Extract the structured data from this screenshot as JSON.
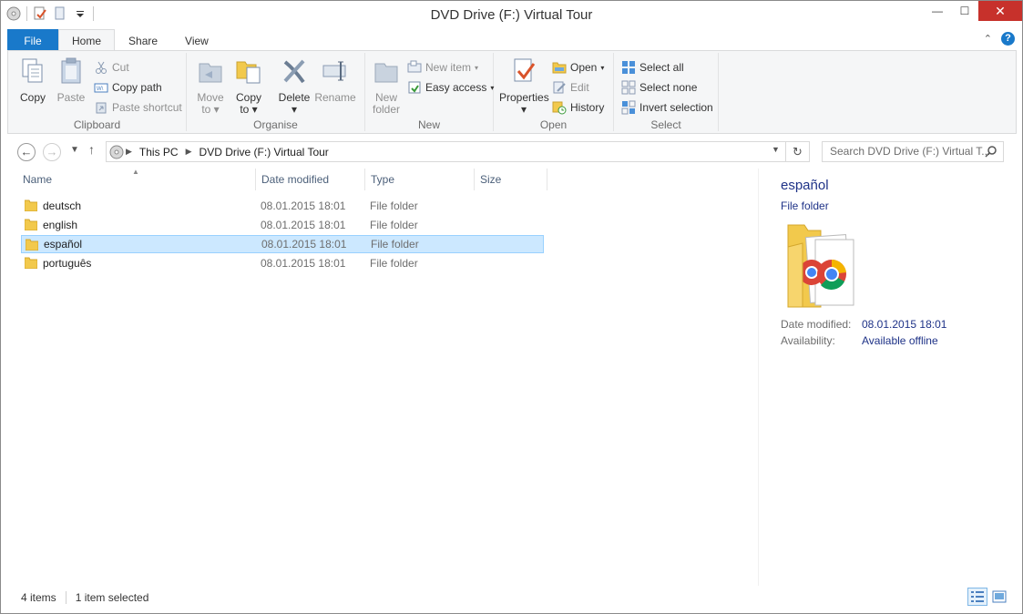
{
  "window": {
    "title": "DVD Drive (F:) Virtual Tour"
  },
  "tabs": [
    {
      "label": "File"
    },
    {
      "label": "Home"
    },
    {
      "label": "Share"
    },
    {
      "label": "View"
    }
  ],
  "ribbon": {
    "clipboard": {
      "label": "Clipboard",
      "copy": "Copy",
      "paste": "Paste",
      "cut": "Cut",
      "copy_path": "Copy path",
      "paste_shortcut": "Paste shortcut"
    },
    "organise": {
      "label": "Organise",
      "move_to_1": "Move",
      "move_to_2": "to",
      "copy_to_1": "Copy",
      "copy_to_2": "to",
      "delete": "Delete",
      "rename": "Rename"
    },
    "new": {
      "label": "New",
      "new_folder_1": "New",
      "new_folder_2": "folder",
      "new_item": "New item",
      "easy_access": "Easy access"
    },
    "open": {
      "label": "Open",
      "properties": "Properties",
      "open": "Open",
      "edit": "Edit",
      "history": "History"
    },
    "select": {
      "label": "Select",
      "select_all": "Select all",
      "select_none": "Select none",
      "invert": "Invert selection"
    }
  },
  "address": {
    "crumbs": [
      "This PC",
      "DVD Drive (F:) Virtual Tour"
    ],
    "search_placeholder": "Search DVD Drive (F:) Virtual T..."
  },
  "columns": {
    "name": "Name",
    "date": "Date modified",
    "type": "Type",
    "size": "Size"
  },
  "files": [
    {
      "name": "deutsch",
      "date": "08.01.2015 18:01",
      "type": "File folder"
    },
    {
      "name": "english",
      "date": "08.01.2015 18:01",
      "type": "File folder"
    },
    {
      "name": "español",
      "date": "08.01.2015 18:01",
      "type": "File folder"
    },
    {
      "name": "português",
      "date": "08.01.2015 18:01",
      "type": "File folder"
    }
  ],
  "selected_index": 2,
  "preview": {
    "title": "español",
    "type": "File folder",
    "date_label": "Date modified:",
    "date_value": "08.01.2015 18:01",
    "avail_label": "Availability:",
    "avail_value": "Available offline"
  },
  "status": {
    "items": "4 items",
    "selected": "1 item selected"
  },
  "colors": {
    "accent": "#1979ca",
    "selection": "#cce8ff",
    "close": "#c7312b",
    "folder": "#f2c94c"
  }
}
